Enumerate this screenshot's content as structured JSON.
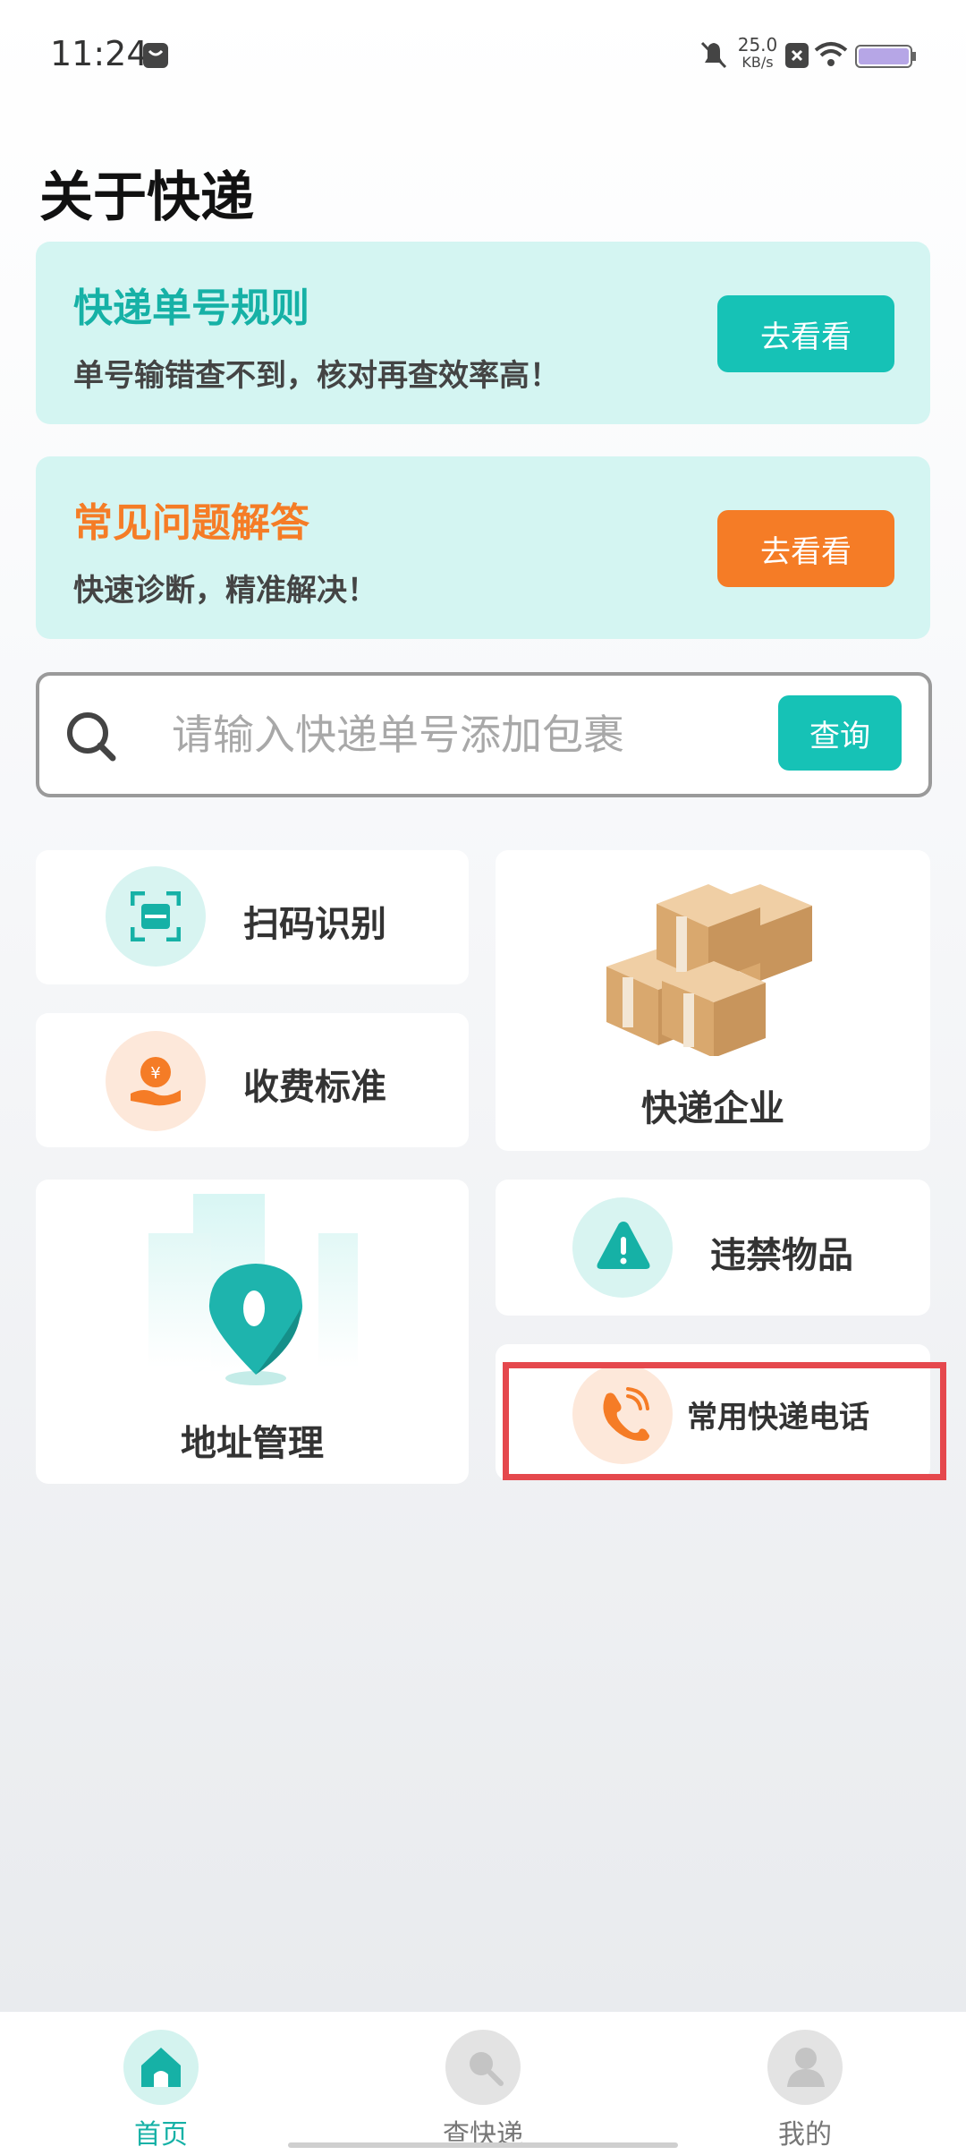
{
  "status_bar": {
    "time": "11:24",
    "net_speed_value": "25.0",
    "net_speed_unit": "KB/s"
  },
  "page_title": "关于快递",
  "banners": [
    {
      "title": "快递单号规则",
      "subtitle": "单号输错查不到，核对再查效率高！",
      "button": "去看看",
      "accent": "#16c2b6"
    },
    {
      "title": "常见问题解答",
      "subtitle": "快速诊断，精准解决！",
      "button": "去看看",
      "accent": "#f57c26"
    }
  ],
  "search": {
    "placeholder": "请输入快递单号添加包裹",
    "button": "查询"
  },
  "tiles": {
    "scan": "扫码识别",
    "fee": "收费标准",
    "companies": "快递企业",
    "address": "地址管理",
    "prohibited": "违禁物品",
    "phone": "常用快递电话"
  },
  "nav": [
    {
      "label": "首页",
      "icon": "home-icon",
      "active": true
    },
    {
      "label": "查快递",
      "icon": "search-icon",
      "active": false
    },
    {
      "label": "我的",
      "icon": "user-icon",
      "active": false
    }
  ],
  "colors": {
    "teal": "#16c2b6",
    "orange": "#f57c26",
    "highlight": "#e5484d"
  }
}
